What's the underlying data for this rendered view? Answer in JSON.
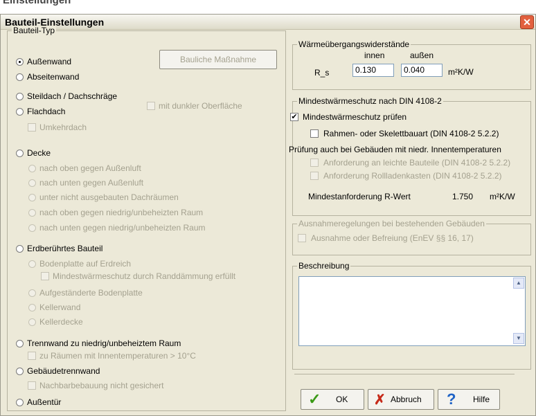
{
  "strip_text": "Einstellungen",
  "window": {
    "title": "Bauteil-Einstellungen",
    "close_glyph": "✕"
  },
  "bauteil_typ": {
    "legend": "Bauteil-Typ",
    "bauliche_button": "Bauliche Maßnahme",
    "aussenwand": "Außenwand",
    "abseitenwand": "Abseitenwand",
    "steildach": "Steildach / Dachschräge",
    "flachdach": "Flachdach",
    "dunkle_oberflaeche": "mit dunkler Oberfläche",
    "umkehrdach": "Umkehrdach",
    "decke": "Decke",
    "decke_oben_aussen": "nach oben gegen Außenluft",
    "decke_unten_aussen": "nach unten gegen Außenluft",
    "decke_dachraum": "unter nicht ausgebauten Dachräumen",
    "decke_oben_niedrig": "nach oben gegen niedrig/unbeheizten Raum",
    "decke_unten_niedrig": "nach unten gegen niedrig/unbeheizten Raum",
    "erdberuehrt": "Erdberührtes Bauteil",
    "bodenplatte": "Bodenplatte auf Erdreich",
    "randdaemmung": "Mindestwärmeschutz durch Randdämmung erfüllt",
    "aufgestaendert": "Aufgeständerte Bodenplatte",
    "kellerwand": "Kellerwand",
    "kellerdecke": "Kellerdecke",
    "trennwand": "Trennwand zu niedrig/unbeheiztem Raum",
    "innentemp": "zu Räumen mit Innentemperaturen > 10°C",
    "gebaeudetrennwand": "Gebäudetrennwand",
    "nachbar": "Nachbarbebauung nicht gesichert",
    "aussentuer": "Außentür"
  },
  "waerme": {
    "legend": "Wärmeübergangswiderstände",
    "innen_label": "innen",
    "aussen_label": "außen",
    "rs_label": "R_s",
    "innen_value": "0.130",
    "aussen_value": "0.040",
    "unit": "m²K/W"
  },
  "mindest": {
    "legend": "Mindestwärmeschutz nach DIN 4108-2",
    "pruefen": "Mindestwärmeschutz prüfen",
    "rahmen": "Rahmen- oder Skelettbauart (DIN 4108-2 5.2.2)",
    "pruefung_text": "Prüfung auch bei Gebäuden mit niedr. Innentemperaturen",
    "leichte": "Anforderung an leichte Bauteile (DIN 4108-2 5.2.2)",
    "rollladen": "Anforderung Rollladenkasten (DIN 4108-2 5.2.2)",
    "anforderung_label": "Mindestanforderung R-Wert",
    "anforderung_value": "1.750",
    "anforderung_unit": "m²K/W"
  },
  "ausnahme": {
    "legend": "Ausnahmeregelungen bei bestehenden Gebäuden",
    "befreiung": "Ausnahme oder Befreiung (EnEV §§ 16, 17)"
  },
  "beschreibung": {
    "legend": "Beschreibung",
    "text": ""
  },
  "buttons": {
    "ok": "OK",
    "abbruch": "Abbruch",
    "hilfe": "Hilfe"
  },
  "glyphs": {
    "check": "✓",
    "cross": "✗",
    "question": "?",
    "scroll_up": "▲",
    "scroll_down": "▼",
    "checkmark": "✔"
  }
}
